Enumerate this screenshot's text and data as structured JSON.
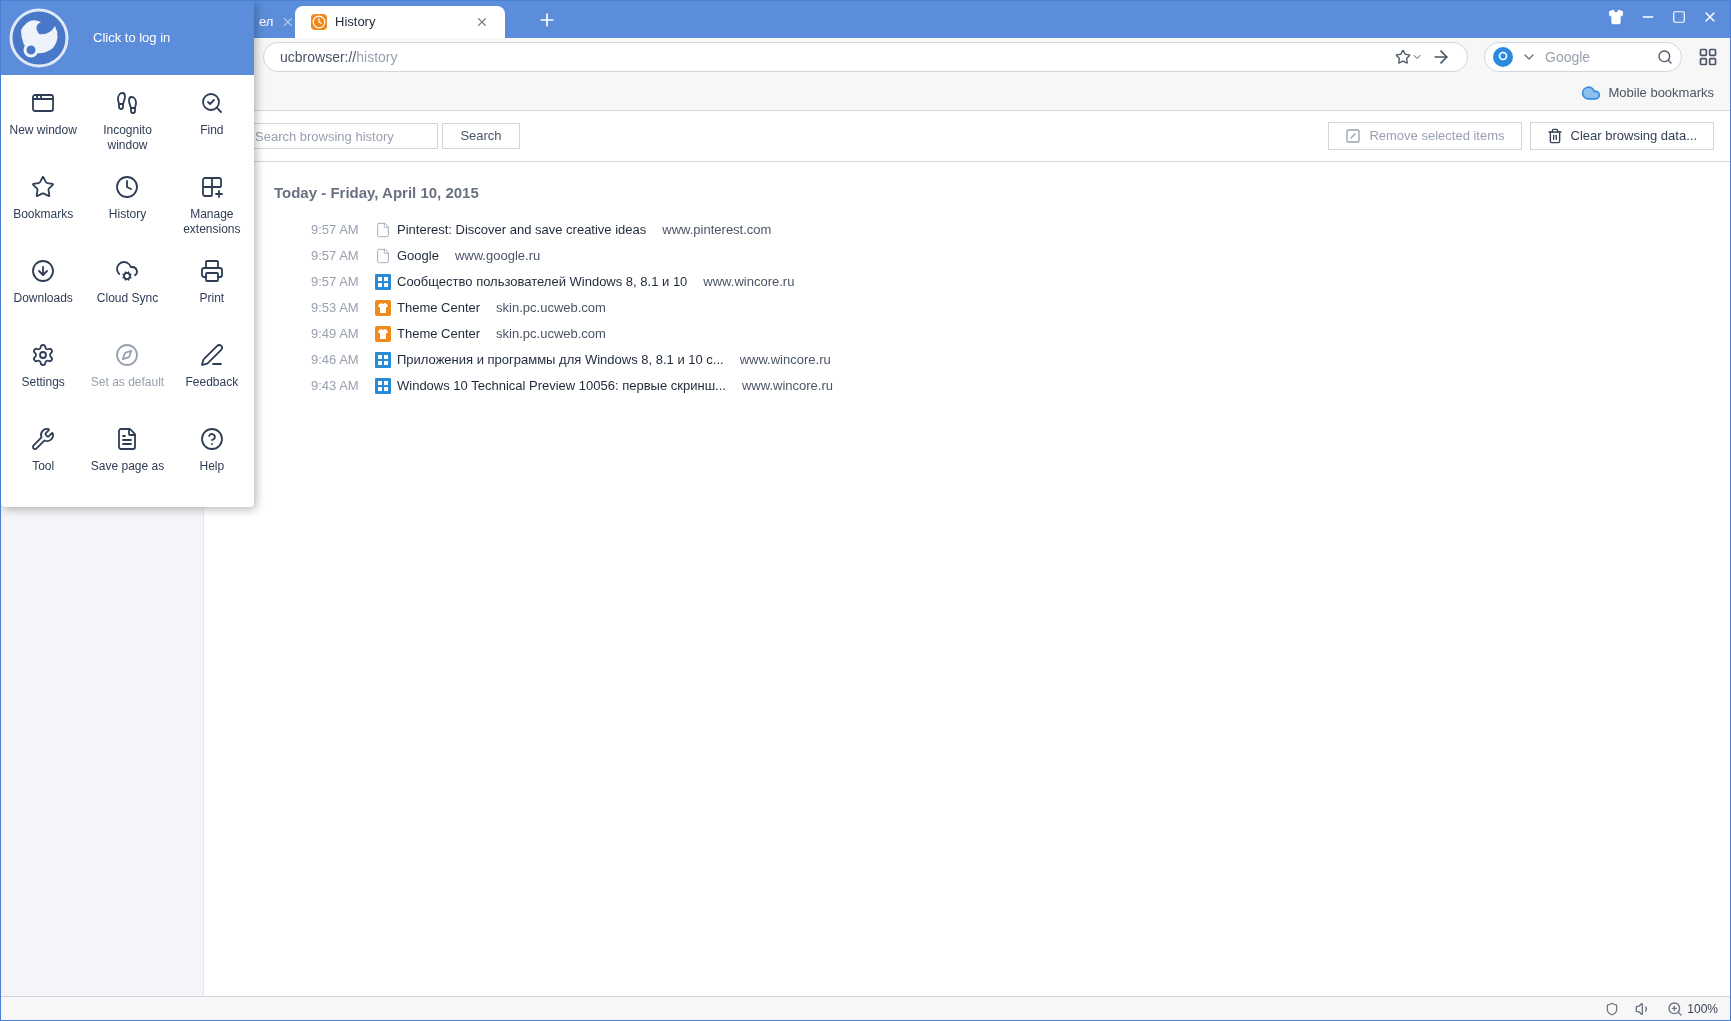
{
  "tabs": [
    {
      "title": "ел",
      "selected": false
    },
    {
      "title": "History",
      "selected": true
    }
  ],
  "address_bar": {
    "url_host": "ucbrowser://",
    "url_path": "history"
  },
  "search_box": {
    "placeholder": "Google"
  },
  "bookmarks_bar": {
    "mobile_bookmarks": "Mobile bookmarks"
  },
  "history_toolbar": {
    "search_placeholder": "Search browsing history",
    "search_button": "Search",
    "remove_button": {
      "label": "Remove selected items",
      "disabled": true
    },
    "clear_button": {
      "label": "Clear browsing data...",
      "disabled": false
    }
  },
  "history": {
    "date_heading": "Today - Friday, April 10, 2015",
    "rows": [
      {
        "time": "9:57 AM",
        "kind": "page",
        "title": "Pinterest: Discover and save creative ideas",
        "url": "www.pinterest.com"
      },
      {
        "time": "9:57 AM",
        "kind": "page",
        "title": "Google",
        "url": "www.google.ru"
      },
      {
        "time": "9:57 AM",
        "kind": "windows",
        "title": "Сообщество пользователей Windows 8, 8.1 и 10",
        "url": "www.wincore.ru"
      },
      {
        "time": "9:53 AM",
        "kind": "theme",
        "title": "Theme Center",
        "url": "skin.pc.ucweb.com"
      },
      {
        "time": "9:49 AM",
        "kind": "theme",
        "title": "Theme Center",
        "url": "skin.pc.ucweb.com"
      },
      {
        "time": "9:46 AM",
        "kind": "windows",
        "title": "Приложения и программы для Windows 8, 8.1 и 10 с...",
        "url": "www.wincore.ru"
      },
      {
        "time": "9:43 AM",
        "kind": "windows",
        "title": "Windows 10 Technical Preview 10056: первые скринш...",
        "url": "www.wincore.ru"
      }
    ]
  },
  "main_menu": {
    "login": "Click to log in",
    "items": [
      {
        "kind": "new-window",
        "label": "New window",
        "disabled": false
      },
      {
        "kind": "incognito",
        "label": "Incognito window",
        "disabled": false
      },
      {
        "kind": "find",
        "label": "Find",
        "disabled": false
      },
      {
        "kind": "bookmarks",
        "label": "Bookmarks",
        "disabled": false
      },
      {
        "kind": "history",
        "label": "History",
        "disabled": false
      },
      {
        "kind": "extensions",
        "label": "Manage extensions",
        "disabled": false
      },
      {
        "kind": "downloads",
        "label": "Downloads",
        "disabled": false
      },
      {
        "kind": "cloud-sync",
        "label": "Cloud Sync",
        "disabled": false
      },
      {
        "kind": "print",
        "label": "Print",
        "disabled": false
      },
      {
        "kind": "settings",
        "label": "Settings",
        "disabled": false
      },
      {
        "kind": "default",
        "label": "Set as default",
        "disabled": true
      },
      {
        "kind": "feedback",
        "label": "Feedback",
        "disabled": false
      },
      {
        "kind": "tool",
        "label": "Tool",
        "disabled": false
      },
      {
        "kind": "save",
        "label": "Save page as",
        "disabled": false
      },
      {
        "kind": "help",
        "label": "Help",
        "disabled": false
      }
    ]
  },
  "status_bar": {
    "zoom": "100%"
  }
}
